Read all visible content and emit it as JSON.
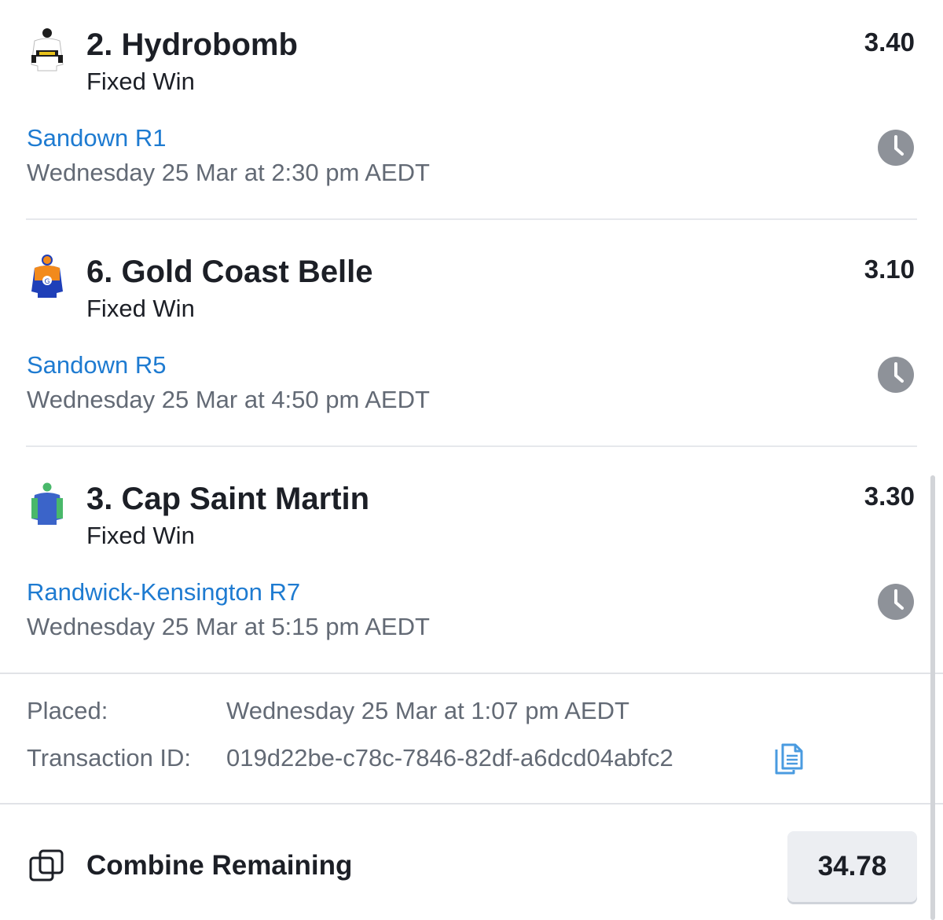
{
  "legs": [
    {
      "name": "2. Hydrobomb",
      "market": "Fixed Win",
      "odds": "3.40",
      "race": "Sandown R1",
      "time": "Wednesday 25 Mar at 2:30 pm AEDT",
      "silk_colors": [
        "#ffffff",
        "#1c1c1c",
        "#e8c21a"
      ],
      "silk_icon": "jockey-silk-icon",
      "status_icon": "clock-icon"
    },
    {
      "name": "6. Gold Coast Belle",
      "market": "Fixed Win",
      "odds": "3.10",
      "race": "Sandown R5",
      "time": "Wednesday 25 Mar at 4:50 pm AEDT",
      "silk_colors": [
        "#f28a1c",
        "#1f3fb8",
        "#ffffff"
      ],
      "silk_icon": "jockey-silk-icon",
      "status_icon": "clock-icon"
    },
    {
      "name": "3. Cap Saint Martin",
      "market": "Fixed Win",
      "odds": "3.30",
      "race": "Randwick-Kensington R7",
      "time": "Wednesday 25 Mar at 5:15 pm AEDT",
      "silk_colors": [
        "#3b64c9",
        "#49b86a",
        "#ffffff"
      ],
      "silk_icon": "jockey-silk-icon",
      "status_icon": "clock-icon"
    }
  ],
  "details": {
    "placed_label": "Placed:",
    "placed_value": "Wednesday 25 Mar at 1:07 pm AEDT",
    "transaction_label": "Transaction ID:",
    "transaction_value": "019d22be-c78c-7846-82df-a6dcd04abfc2",
    "copy_icon": "copy-icon"
  },
  "combine": {
    "label": "Combine Remaining",
    "value": "34.78",
    "icon": "combine-icon"
  },
  "colors": {
    "link": "#1e7bd1",
    "text": "#1c1f26",
    "muted": "#636a75",
    "clock": "#8e9299"
  }
}
